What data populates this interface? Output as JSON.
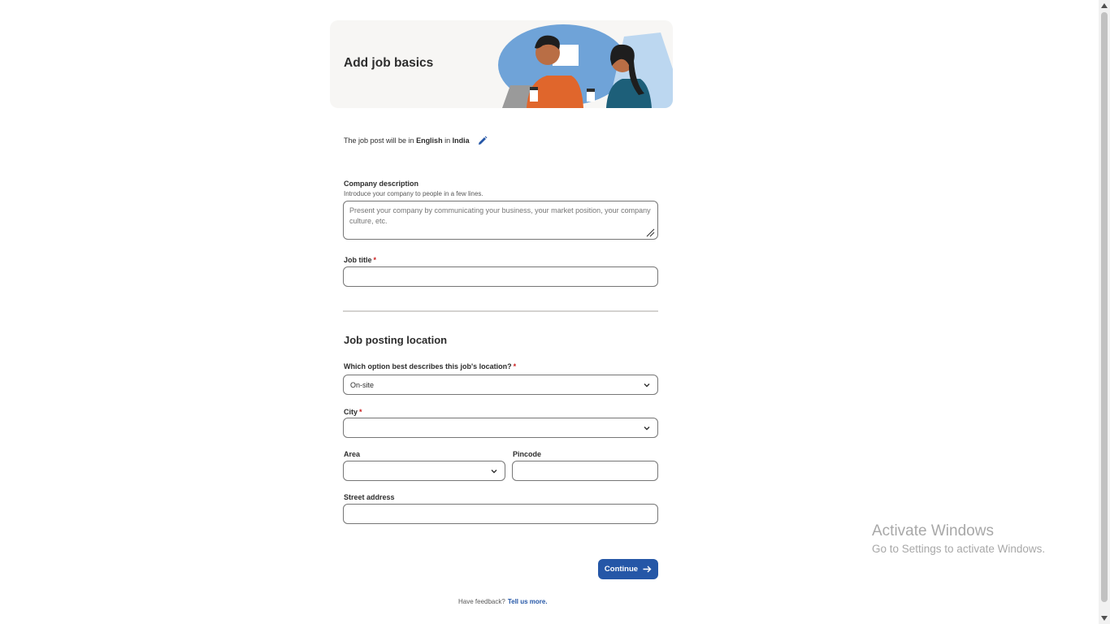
{
  "header": {
    "title": "Add job basics"
  },
  "language_line": {
    "prefix": "The job post will be in",
    "language": "English",
    "connector": "in",
    "country": "India",
    "edit_icon": "pencil-icon"
  },
  "company_description": {
    "label": "Company description",
    "helper": "Introduce your company to people in a few lines.",
    "placeholder": "Present your company by communicating your business, your market position, your company culture, etc.",
    "value": ""
  },
  "job_title": {
    "label": "Job title",
    "required_mark": "*",
    "value": ""
  },
  "location_section": {
    "title": "Job posting location",
    "location_type": {
      "label": "Which option best describes this job's location?",
      "required_mark": "*",
      "value": "On-site"
    },
    "city": {
      "label": "City",
      "required_mark": "*",
      "value": ""
    },
    "area": {
      "label": "Area",
      "value": ""
    },
    "pincode": {
      "label": "Pincode",
      "value": ""
    },
    "street": {
      "label": "Street address",
      "value": ""
    }
  },
  "actions": {
    "continue_label": "Continue",
    "continue_icon": "arrow-right-icon"
  },
  "feedback": {
    "text": "Have feedback?",
    "link": "Tell us more."
  },
  "watermark": {
    "title": "Activate Windows",
    "subtitle": "Go to Settings to activate Windows."
  },
  "colors": {
    "primary": "#2557a7",
    "required": "#c91d1d",
    "border": "#767676",
    "header_bg": "#f7f6f4"
  }
}
